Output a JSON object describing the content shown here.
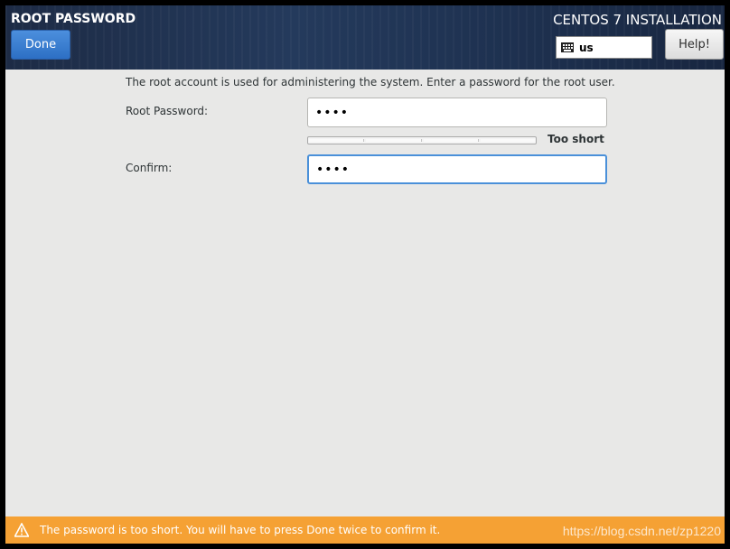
{
  "header": {
    "title": "ROOT PASSWORD",
    "done_label": "Done",
    "install_title": "CENTOS 7 INSTALLATION",
    "keyboard_layout": "us",
    "help_label": "Help!"
  },
  "main": {
    "intro": "The root account is used for administering the system.  Enter a password for the root user.",
    "root_password_label": "Root Password:",
    "root_password_value": "abcd",
    "strength_label": "Too short",
    "strength_level": 0,
    "confirm_label": "Confirm:",
    "confirm_value": "abcd"
  },
  "warning": {
    "icon": "warning-icon",
    "message": "The password is too short. You will have to press Done twice to confirm it.",
    "color": "#f5a134"
  },
  "watermark": "https://blog.csdn.net/zp1220",
  "colors": {
    "accent": "#4a90d9",
    "header_bg": "#1d2b45",
    "warning_bg": "#f5a134"
  }
}
